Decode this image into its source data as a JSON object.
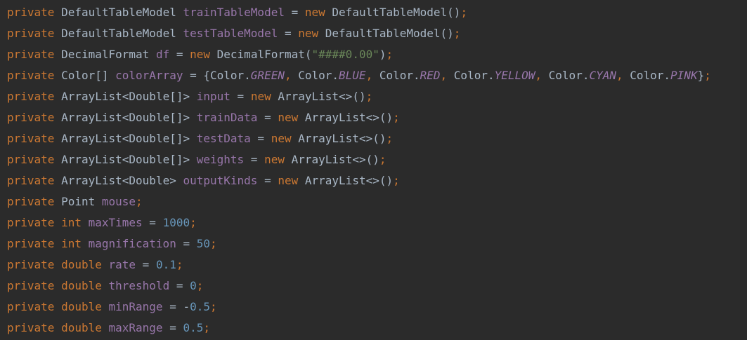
{
  "editor": {
    "colors": {
      "background": "#2b2b2b",
      "plain": "#a9b7c6",
      "keyword": "#cc7832",
      "field": "#9876aa",
      "number": "#6897bb",
      "string": "#6a8759"
    },
    "lines": [
      [
        {
          "t": "kw",
          "v": "private"
        },
        {
          "t": "plain",
          "v": " DefaultTableModel "
        },
        {
          "t": "field",
          "v": "trainTableModel"
        },
        {
          "t": "plain",
          "v": " = "
        },
        {
          "t": "kw",
          "v": "new"
        },
        {
          "t": "plain",
          "v": " DefaultTableModel()"
        },
        {
          "t": "punct",
          "v": ";"
        }
      ],
      [
        {
          "t": "kw",
          "v": "private"
        },
        {
          "t": "plain",
          "v": " DefaultTableModel "
        },
        {
          "t": "field",
          "v": "testTableModel"
        },
        {
          "t": "plain",
          "v": " = "
        },
        {
          "t": "kw",
          "v": "new"
        },
        {
          "t": "plain",
          "v": " DefaultTableModel()"
        },
        {
          "t": "punct",
          "v": ";"
        }
      ],
      [
        {
          "t": "kw",
          "v": "private"
        },
        {
          "t": "plain",
          "v": " DecimalFormat "
        },
        {
          "t": "field",
          "v": "df"
        },
        {
          "t": "plain",
          "v": " = "
        },
        {
          "t": "kw",
          "v": "new"
        },
        {
          "t": "plain",
          "v": " DecimalFormat("
        },
        {
          "t": "str",
          "v": "\"####0.00\""
        },
        {
          "t": "plain",
          "v": ")"
        },
        {
          "t": "punct",
          "v": ";"
        }
      ],
      [
        {
          "t": "kw",
          "v": "private"
        },
        {
          "t": "plain",
          "v": " Color[] "
        },
        {
          "t": "field",
          "v": "colorArray"
        },
        {
          "t": "plain",
          "v": " = {Color."
        },
        {
          "t": "static",
          "v": "GREEN"
        },
        {
          "t": "punct",
          "v": ", "
        },
        {
          "t": "plain",
          "v": "Color."
        },
        {
          "t": "static",
          "v": "BLUE"
        },
        {
          "t": "punct",
          "v": ", "
        },
        {
          "t": "plain",
          "v": "Color."
        },
        {
          "t": "static",
          "v": "RED"
        },
        {
          "t": "punct",
          "v": ", "
        },
        {
          "t": "plain",
          "v": "Color."
        },
        {
          "t": "static",
          "v": "YELLOW"
        },
        {
          "t": "punct",
          "v": ", "
        },
        {
          "t": "plain",
          "v": "Color."
        },
        {
          "t": "static",
          "v": "CYAN"
        },
        {
          "t": "punct",
          "v": ", "
        },
        {
          "t": "plain",
          "v": "Color."
        },
        {
          "t": "static",
          "v": "PINK"
        },
        {
          "t": "plain",
          "v": "}"
        },
        {
          "t": "punct",
          "v": ";"
        }
      ],
      [
        {
          "t": "kw",
          "v": "private"
        },
        {
          "t": "plain",
          "v": " ArrayList<Double[]> "
        },
        {
          "t": "field",
          "v": "input"
        },
        {
          "t": "plain",
          "v": " = "
        },
        {
          "t": "kw",
          "v": "new"
        },
        {
          "t": "plain",
          "v": " ArrayList<>()"
        },
        {
          "t": "punct",
          "v": ";"
        }
      ],
      [
        {
          "t": "kw",
          "v": "private"
        },
        {
          "t": "plain",
          "v": " ArrayList<Double[]> "
        },
        {
          "t": "field",
          "v": "trainData"
        },
        {
          "t": "plain",
          "v": " = "
        },
        {
          "t": "kw",
          "v": "new"
        },
        {
          "t": "plain",
          "v": " ArrayList<>()"
        },
        {
          "t": "punct",
          "v": ";"
        }
      ],
      [
        {
          "t": "kw",
          "v": "private"
        },
        {
          "t": "plain",
          "v": " ArrayList<Double[]> "
        },
        {
          "t": "field",
          "v": "testData"
        },
        {
          "t": "plain",
          "v": " = "
        },
        {
          "t": "kw",
          "v": "new"
        },
        {
          "t": "plain",
          "v": " ArrayList<>()"
        },
        {
          "t": "punct",
          "v": ";"
        }
      ],
      [
        {
          "t": "kw",
          "v": "private"
        },
        {
          "t": "plain",
          "v": " ArrayList<Double[]> "
        },
        {
          "t": "field",
          "v": "weights"
        },
        {
          "t": "plain",
          "v": " = "
        },
        {
          "t": "kw",
          "v": "new"
        },
        {
          "t": "plain",
          "v": " ArrayList<>()"
        },
        {
          "t": "punct",
          "v": ";"
        }
      ],
      [
        {
          "t": "kw",
          "v": "private"
        },
        {
          "t": "plain",
          "v": " ArrayList<Double> "
        },
        {
          "t": "field",
          "v": "outputKinds"
        },
        {
          "t": "plain",
          "v": " = "
        },
        {
          "t": "kw",
          "v": "new"
        },
        {
          "t": "plain",
          "v": " ArrayList<>()"
        },
        {
          "t": "punct",
          "v": ";"
        }
      ],
      [
        {
          "t": "kw",
          "v": "private"
        },
        {
          "t": "plain",
          "v": " Point "
        },
        {
          "t": "field",
          "v": "mouse"
        },
        {
          "t": "punct",
          "v": ";"
        }
      ],
      [
        {
          "t": "kw",
          "v": "private int "
        },
        {
          "t": "field",
          "v": "maxTimes"
        },
        {
          "t": "plain",
          "v": " = "
        },
        {
          "t": "num",
          "v": "1000"
        },
        {
          "t": "punct",
          "v": ";"
        }
      ],
      [
        {
          "t": "kw",
          "v": "private int "
        },
        {
          "t": "field",
          "v": "magnification"
        },
        {
          "t": "plain",
          "v": " = "
        },
        {
          "t": "num",
          "v": "50"
        },
        {
          "t": "punct",
          "v": ";"
        }
      ],
      [
        {
          "t": "kw",
          "v": "private double "
        },
        {
          "t": "field",
          "v": "rate"
        },
        {
          "t": "plain",
          "v": " = "
        },
        {
          "t": "num",
          "v": "0.1"
        },
        {
          "t": "punct",
          "v": ";"
        }
      ],
      [
        {
          "t": "kw",
          "v": "private double "
        },
        {
          "t": "field",
          "v": "threshold"
        },
        {
          "t": "plain",
          "v": " = "
        },
        {
          "t": "num",
          "v": "0"
        },
        {
          "t": "punct",
          "v": ";"
        }
      ],
      [
        {
          "t": "kw",
          "v": "private double "
        },
        {
          "t": "field",
          "v": "minRange"
        },
        {
          "t": "plain",
          "v": " = -"
        },
        {
          "t": "num",
          "v": "0.5"
        },
        {
          "t": "punct",
          "v": ";"
        }
      ],
      [
        {
          "t": "kw",
          "v": "private double "
        },
        {
          "t": "field",
          "v": "maxRange"
        },
        {
          "t": "plain",
          "v": " = "
        },
        {
          "t": "num",
          "v": "0.5"
        },
        {
          "t": "punct",
          "v": ";"
        }
      ]
    ]
  }
}
